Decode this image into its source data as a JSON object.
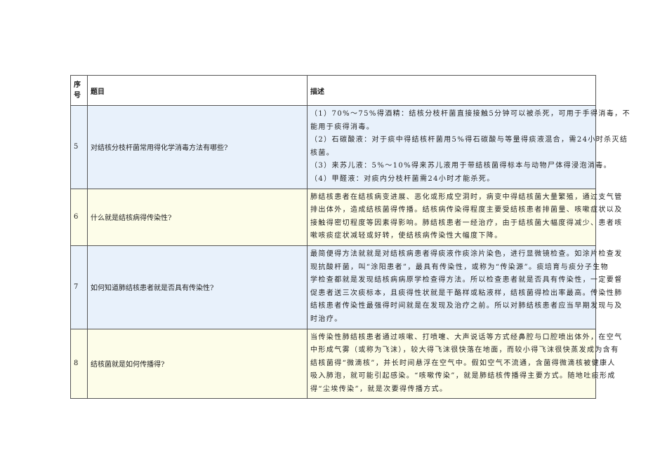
{
  "header": {
    "seq": [
      "序",
      "号"
    ],
    "question": "题目",
    "description": "描述"
  },
  "rows": [
    {
      "seq": "5",
      "question": "对结核分枝杆菌常用得化学消毒方法有哪些?",
      "lines": [
        "（1）70%～75%得酒精：结核分枝杆菌直接接触5分钟可以被杀死，可用于手得消毒，不",
        "能用于痰得消毒。",
        "（2）石碳酸液：对于痰中得结核杆菌用5%得石碳酸与等量得痰液混合，需24小时杀灭结",
        "核菌。",
        "（3）来苏儿液：5%～10%得来苏儿液用于带结核菌得标本与动物尸体得浸泡消毒。",
        "（4）甲醛液：对痰内分枝杆菌需24小时才能杀死。"
      ]
    },
    {
      "seq": "6",
      "question": "什么就是结核病得传染性?",
      "lines": [
        "肺结核患者在结核病变进展、恶化或形成空洞时，病变中得结核菌大量繁殖，通过支气管",
        "排出体外，造成结核菌得传播。结核病传染得程度主要受结核患者排菌量、咳嗽症状以及",
        "接触得密切程度等因素得影响。肺结核患者一经治疗，由于结核菌大幅度得减少、患者咳",
        "嗽咳痰症状减轻或好转，使结核病传染性大幅度下降。"
      ]
    },
    {
      "seq": "7",
      "question": "如何知道肺结核患者就是否具有传染性?",
      "lines": [
        "最简便得方法就就是对结核病患者得痰液作痰涂片染色，进行显微镜检查。如涂片检查发",
        "现抗酸杆菌，叫“涂阳患者”，最具有传染性，或称为“传染源”。痰培育与痰分子生物",
        "学检查都就是发现结核病病原学检查得方法。所以检查患者就是否具有传染性，一定要督",
        "促患者送三次痰标本，且痰得性状就是干酪样或粘液样，结核菌得检出率最高。传染性肺",
        "结核患者传染性最强得时间就是在发现及治疗之前。所以对肺结核患者应当早期发现与及",
        "时治疗。"
      ]
    },
    {
      "seq": "8",
      "question": "结核菌就是如何传播得?",
      "lines": [
        "当传染性肺结核患者通过咳嗽、打喷嚏、大声说话等方式经鼻腔与口腔喷出体外，在空气",
        "中形成气雾（或称为飞沫），较大得飞沫很快落在地面，而较小得飞沫很快蒸发成为含有",
        "结核菌得“微滴核”，并长时间悬浮在空气中。假如空气不流通，含菌得微滴核被健康人",
        "吸入肺泡，就可能引起感染。“咳嗽传染”，就是肺结核传播得主要方式。随地吐痰形成",
        "得“尘埃传染”，就是次要得传播方式。"
      ]
    }
  ]
}
